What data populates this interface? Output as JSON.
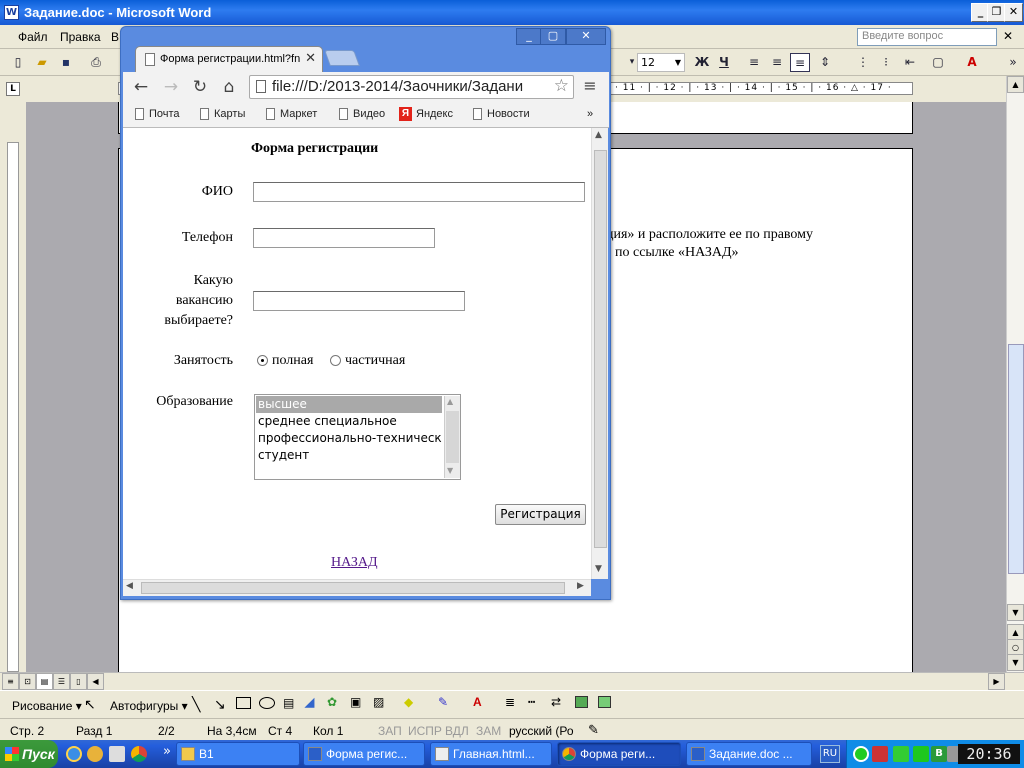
{
  "word": {
    "title": "Задание.doc - Microsoft Word",
    "menu": [
      "Файл",
      "Правка",
      "В"
    ],
    "ask_placeholder": "Введите вопрос",
    "font_size": "12",
    "bold_label": "Ж",
    "underline_label": "Ч",
    "ruler_numbers": "· 11 · | · 12 · | · 13 · | · 14 · | · 15 · | · 16 · △ · 17 ·",
    "doc_line1": "ция»  и расположите ее по правому",
    "doc_line2": "по ссылке «НАЗАД»",
    "draw_toolbar": {
      "drawing": "Рисование ▾",
      "autoshapes": "Автофигуры ▾"
    },
    "status": {
      "page": "Стр.  2",
      "section": "Разд  1",
      "pages": "2/2",
      "at": "На 3,4см",
      "line": "Ст  4",
      "col": "Кол  1",
      "rec": "ЗАП",
      "trk": "ИСПР",
      "ext": "ВДЛ",
      "ovr": "ЗАМ",
      "lang": "русский (Ро"
    }
  },
  "chrome": {
    "tab_title": "Форма регистрации.html?fn",
    "url": "file:///D:/2013-2014/Заочники/Задани",
    "bookmarks": [
      "Почта",
      "Карты",
      "Маркет",
      "Видео",
      "Яндекс",
      "Новости"
    ],
    "more": "»"
  },
  "form": {
    "heading": "Форма регистрации",
    "fio_label": "ФИО",
    "phone_label": "Телефон",
    "vacancy_label_1": "Какую",
    "vacancy_label_2": "вакансию",
    "vacancy_label_3": "выбираете?",
    "employment_label": "Занятость",
    "employment_options": [
      "полная",
      "частичная"
    ],
    "employment_selected": "полная",
    "education_label": "Образование",
    "education_options": [
      "высшее",
      "среднее специальное",
      "профессионально-техническое",
      "студент"
    ],
    "education_selected": "высшее",
    "submit_label": "Регистрация",
    "back_link": "НАЗАД"
  },
  "taskbar": {
    "start": "Пуск",
    "quick_more": "»",
    "items": [
      "В1",
      "Форма регис...",
      "Главная.html...",
      "Форма реги...",
      "Задание.doc ..."
    ],
    "lang": "RU",
    "clock": "20:36"
  }
}
